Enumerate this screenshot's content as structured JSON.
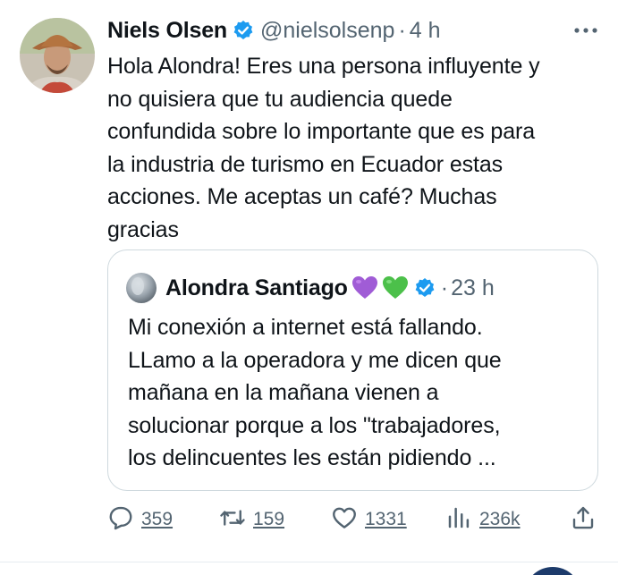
{
  "tweet": {
    "author_name": "Niels Olsen",
    "handle": "@nielsolsenp",
    "separator": "·",
    "time": "4 h",
    "text_lines": [
      "Hola Alondra! Eres una persona influyente y",
      "no quisiera que tu audiencia quede",
      "confundida sobre lo importante que es para",
      "la industria de turismo en Ecuador estas",
      "acciones. Me aceptas un café? Muchas",
      "gracias"
    ],
    "more_icon": "more-horizontal-icon",
    "verified_icon": "verified-badge-icon"
  },
  "quote": {
    "author_name": "Alondra Santiago",
    "separator": "·",
    "time": "23 h",
    "emojis": [
      "purple-heart",
      "green-heart"
    ],
    "text_lines": [
      "Mi conexión a internet está fallando.",
      "LLamo a la operadora y me dicen que",
      "mañana en la mañana vienen a",
      "solucionar porque a los \"trabajadores,",
      "los delincuentes les están pidiendo ..."
    ]
  },
  "actions": {
    "replies": "359",
    "reposts": "159",
    "likes": "1331",
    "views": "236k",
    "icons": [
      "reply-icon",
      "repost-icon",
      "like-icon",
      "views-icon",
      "share-icon"
    ]
  },
  "colors": {
    "text": "#0f1419",
    "secondary": "#536471",
    "verified": "#1d9bf0",
    "border": "#cfd9de",
    "purple_heart": "#a05cd6",
    "green_heart": "#4cc04a"
  }
}
